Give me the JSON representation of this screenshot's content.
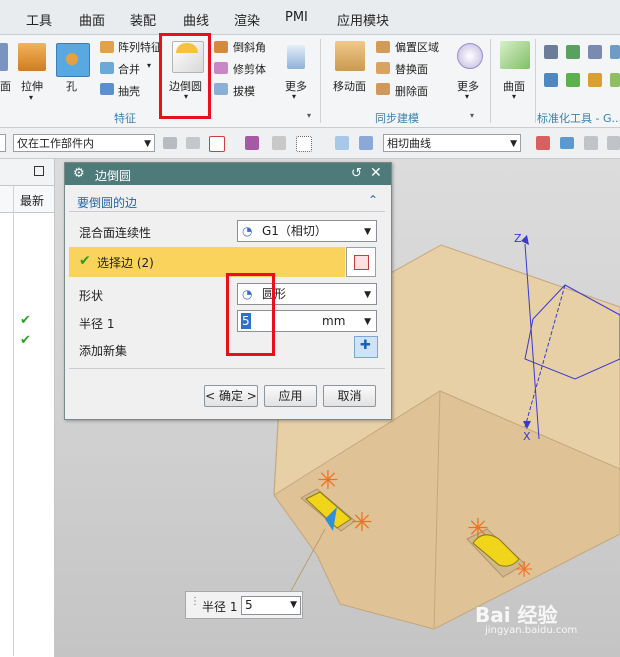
{
  "menu": [
    "工具",
    "曲面",
    "装配",
    "曲线",
    "渲染",
    "PMI",
    "应用模块"
  ],
  "ribbon": {
    "extrude": "拉伸",
    "hole": "孔",
    "pattern_feature": "阵列特征",
    "unite": "合并",
    "shell": "抽壳",
    "group_feature": "特征",
    "edge_blend": "边倒圆",
    "chamfer": "倒斜角",
    "trim_body": "修剪体",
    "draft": "拔模",
    "more1": "更多",
    "move_face": "移动面",
    "offset_region": "偏置区域",
    "replace_face": "替换面",
    "delete_face": "删除面",
    "group_sync": "同步建模",
    "more2": "更多",
    "surface": "曲面",
    "group_std": "标准化工具 - G..."
  },
  "toolbar": {
    "scope_select": "仅在工作部件内",
    "curve_rule": "相切曲线"
  },
  "nav": {
    "col_header": "最新",
    "check1": "✔",
    "check2": "✔"
  },
  "dialog": {
    "title": "边倒圆",
    "section": "要倒圆的边",
    "continuity_label": "混合面连续性",
    "continuity_value": "G1（相切）",
    "select_edge": "选择边 (2)",
    "shape_label": "形状",
    "shape_value": "圆形",
    "radius_label": "半径 1",
    "radius_value": "5",
    "radius_unit": "mm",
    "add_set_label": "添加新集",
    "ok": "< 确定 >",
    "apply": "应用",
    "cancel": "取消"
  },
  "callout": {
    "label": "半径 1",
    "value": "5"
  },
  "axes": {
    "z": "Z",
    "x": "X"
  },
  "watermark": {
    "brand": "Bai 经验",
    "url": "jingyan.baidu.com"
  },
  "colors": {
    "title_bar": "#4f7a7a",
    "highlight_row": "#f9d35c",
    "part_face": "#e7cfa6",
    "selected_edge": "#f0d51a",
    "red_box": "#e8101a"
  }
}
